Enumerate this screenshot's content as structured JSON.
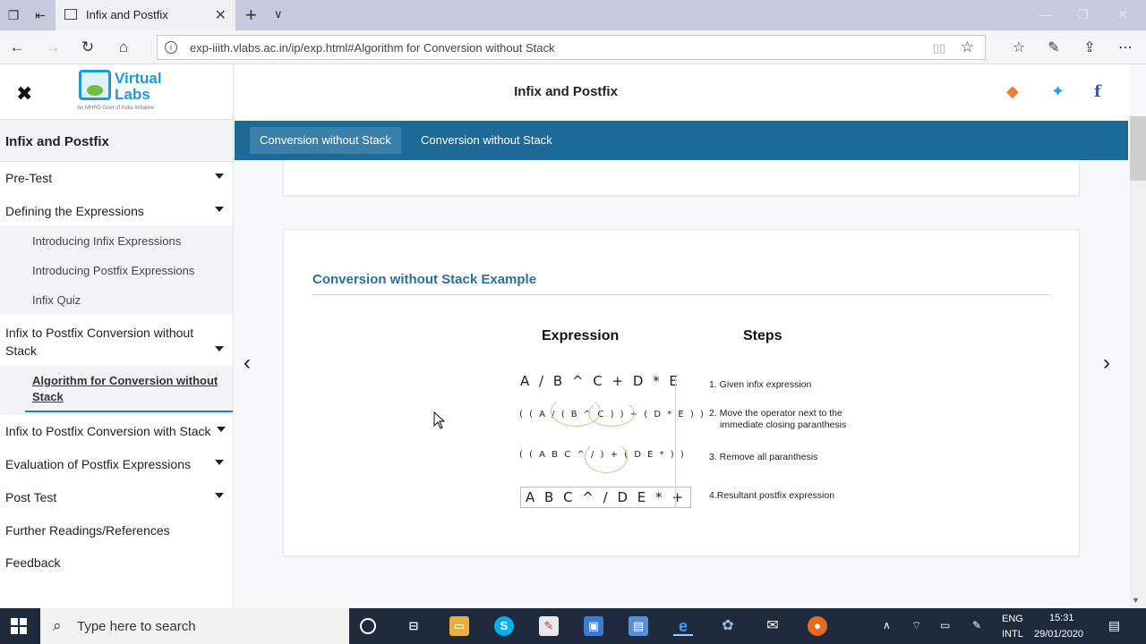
{
  "browser": {
    "tab_title": "Infix and Postfix",
    "url": "exp-iiith.vlabs.ac.in/ip/exp.html#Algorithm for Conversion without Stack"
  },
  "logo": {
    "line1": "Virtual",
    "line2": "Labs",
    "tagline": "An MHRD Govt of India Initiative"
  },
  "sidebar": {
    "title": "Infix and Postfix",
    "items": [
      {
        "label": "Pre-Test",
        "expandable": true
      },
      {
        "label": "Defining the Expressions",
        "expandable": true
      },
      {
        "label": "Infix to Postfix Conversion without Stack",
        "expandable": true
      },
      {
        "label": "Infix to Postfix Conversion with Stack",
        "expandable": true
      },
      {
        "label": "Evaluation of Postfix Expressions",
        "expandable": true
      },
      {
        "label": "Post Test",
        "expandable": true
      },
      {
        "label": "Further Readings/References",
        "expandable": false
      },
      {
        "label": "Feedback",
        "expandable": false
      }
    ],
    "sub_defining": [
      "Introducing Infix Expressions",
      "Introducing Postfix Expressions",
      "Infix Quiz"
    ],
    "sub_without_stack_active": "Algorithm for Conversion without Stack"
  },
  "header": {
    "title": "Infix and Postfix"
  },
  "content_tabs": [
    "Conversion without Stack",
    "Conversion without Stack"
  ],
  "card": {
    "heading": "Conversion without Stack Example",
    "col_expression": "Expression",
    "col_steps": "Steps",
    "expressions": [
      "A / B ^ C + D * E",
      "( ( A / ( B ^ C ) ) + ( D * E ) )",
      "( ( A B C ^ / ) + ( D E * ) )",
      "A B C ^ / D E * +"
    ],
    "steps": [
      "1. Given infix expression",
      "2. Move the operator next to the",
      "immediate closing paranthesis",
      "3. Remove all paranthesis",
      "4.Resultant postfix expression"
    ]
  },
  "taskbar": {
    "search_placeholder": "Type here to search",
    "lang1": "ENG",
    "lang2": "INTL",
    "time": "15:31",
    "date": "29/01/2020"
  },
  "colors": {
    "tabbar": "#1d6a98",
    "heading": "#2d6e9c",
    "taskbar": "#1f2b3c"
  }
}
